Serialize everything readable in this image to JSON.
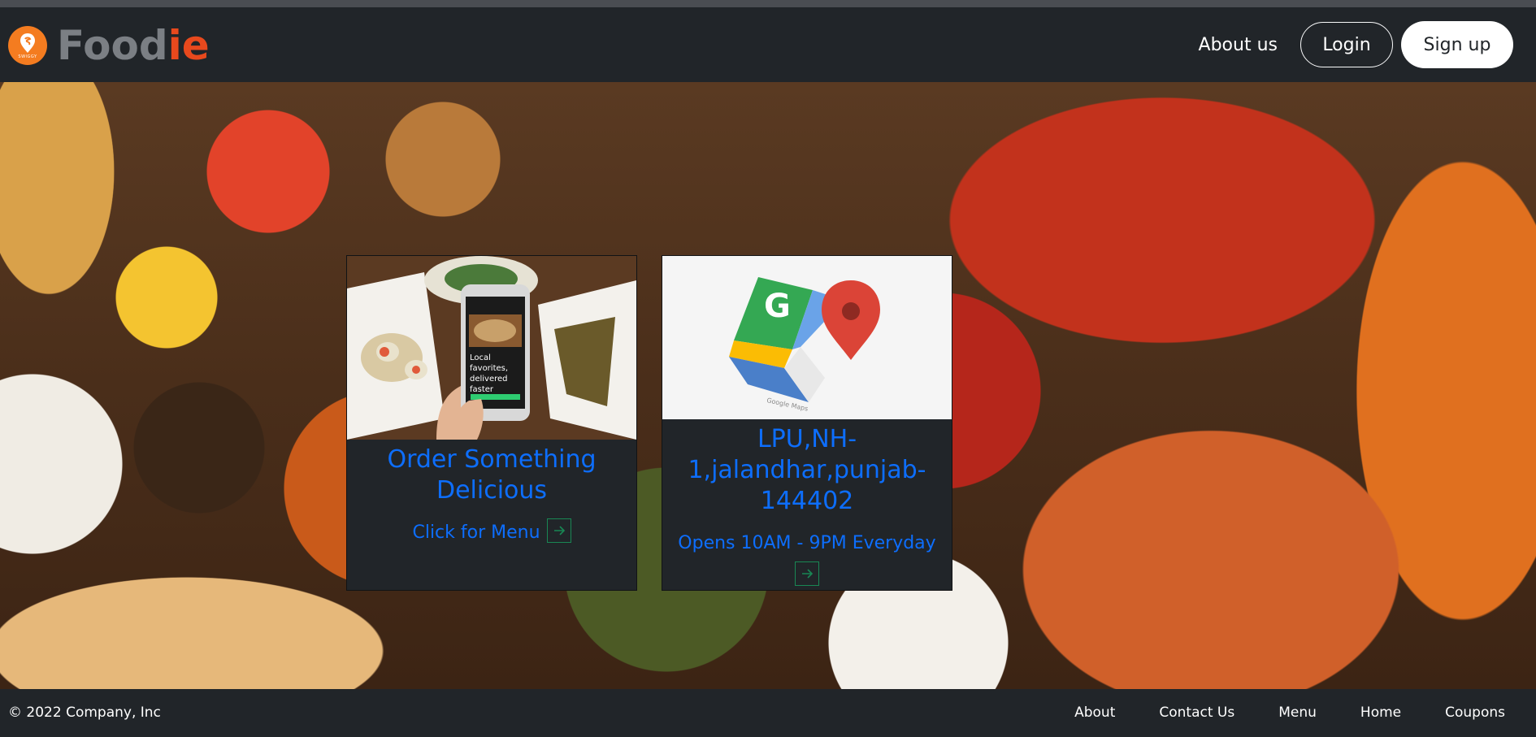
{
  "brand": {
    "logo_caption": "SWIGGY",
    "name_part1": "Food",
    "name_part2": "ie"
  },
  "nav": {
    "about": "About us",
    "login": "Login",
    "signup": "Sign up"
  },
  "cards": [
    {
      "image_caption": "Local favorites, delivered faster",
      "title": "Order Something Delicious",
      "text": "Click for Menu",
      "icon": "arrow-right-icon"
    },
    {
      "image_caption": "Google Maps",
      "title": "LPU,NH-1,jalandhar,punjab-144402",
      "text": "Opens 10AM - 9PM Everyday",
      "icon": "arrow-right-icon"
    }
  ],
  "footer": {
    "copyright": "© 2022 Company, Inc",
    "links": [
      "About",
      "Contact Us",
      "Menu",
      "Home",
      "Coupons"
    ]
  },
  "colors": {
    "navbar_bg": "#212529",
    "link_primary": "#0d6efd",
    "icon_green": "#198754",
    "brand_orange": "#e8491d",
    "brand_gray": "#7b7f84"
  }
}
